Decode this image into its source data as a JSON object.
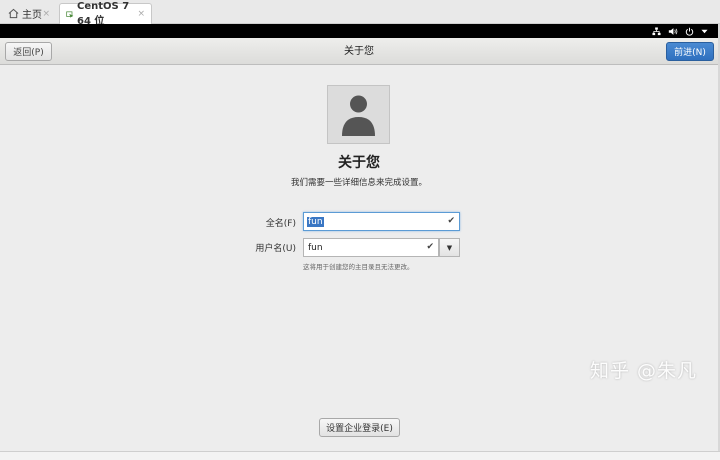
{
  "browser_tabs": [
    {
      "label": "主页",
      "icon": "home-icon",
      "close": "×"
    },
    {
      "label": "CentOS 7 64 位",
      "icon": "vm-icon",
      "close": "×"
    }
  ],
  "top_bar": {
    "icons": [
      "network-icon",
      "volume-icon",
      "power-icon",
      "chevron-down-icon"
    ]
  },
  "header": {
    "back_label": "返回(P)",
    "title": "关于您",
    "next_label": "前进(N)"
  },
  "main": {
    "avatar_icon": "user-avatar-icon",
    "title": "关于您",
    "subtitle": "我们需要一些详细信息来完成设置。",
    "full_name_label": "全名(F)",
    "full_name_value": "fun",
    "username_label": "用户名(U)",
    "username_value": "fun",
    "username_hint": "这将用于创建您的主目录且无法更改。",
    "enterprise_login_label": "设置企业登录(E)"
  },
  "watermark": "知乎 @朱凡",
  "colors": {
    "accent": "#2f70bf",
    "selection": "#3a77c4",
    "background": "#ededed"
  }
}
